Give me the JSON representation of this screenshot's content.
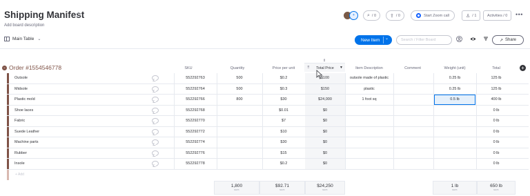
{
  "board": {
    "title": "Shipping Manifest",
    "subtitle": "Add board description"
  },
  "header": {
    "activity_count": "/ 0",
    "share_count": "/ 0",
    "zoom_label": "Start Zoom call",
    "members_count": "/ 1",
    "activities_label": "Activities / 0",
    "more_label": "•••"
  },
  "toolbar": {
    "view_label": "Main Table",
    "new_item_label": "New Item",
    "search_placeholder": "Search / Filter Board",
    "share_label": "Share"
  },
  "group": {
    "title": "Order #1554546778",
    "color": "#7f5347"
  },
  "columns": {
    "sku": "SKU",
    "quantity": "Quantity",
    "price_per_unit": "Price per unit",
    "total_price": "Total Price",
    "item_description": "Item Description",
    "comment": "Comment",
    "weight": "Weight (unit)",
    "total": "Total"
  },
  "rows": [
    {
      "name": "Outsole",
      "sku": "552292763",
      "quantity": "500",
      "price": "$0.2",
      "total_price": "$100",
      "description": "outsole made of plastic",
      "comment": "",
      "weight": "0.25 lb",
      "total": "125 lb"
    },
    {
      "name": "Midsole",
      "sku": "552292764",
      "quantity": "500",
      "price": "$0.3",
      "total_price": "$150",
      "description": "plastic",
      "comment": "",
      "weight": "0.25 lb",
      "total": "125 lb"
    },
    {
      "name": "Plastic mold",
      "sku": "552292766",
      "quantity": "800",
      "price": "$30",
      "total_price": "$24,000",
      "description": "1 foot sq",
      "comment": "",
      "weight": "0.5 lb",
      "total": "400 lb"
    },
    {
      "name": "Shoe laces",
      "sku": "552292768",
      "quantity": "",
      "price": "$0.01",
      "total_price": "$0",
      "description": "",
      "comment": "",
      "weight": "",
      "total": "0 lb"
    },
    {
      "name": "Fabric",
      "sku": "552292770",
      "quantity": "",
      "price": "$7",
      "total_price": "$0",
      "description": "",
      "comment": "",
      "weight": "",
      "total": "0 lb"
    },
    {
      "name": "Suede Leather",
      "sku": "552292772",
      "quantity": "",
      "price": "$10",
      "total_price": "$0",
      "description": "",
      "comment": "",
      "weight": "",
      "total": "0 lb"
    },
    {
      "name": "Machine parts",
      "sku": "552292774",
      "quantity": "",
      "price": "$30",
      "total_price": "$0",
      "description": "",
      "comment": "",
      "weight": "",
      "total": "0 lb"
    },
    {
      "name": "Rubber",
      "sku": "552292776",
      "quantity": "",
      "price": "$15",
      "total_price": "$0",
      "description": "",
      "comment": "",
      "weight": "",
      "total": "0 lb"
    },
    {
      "name": "Insole",
      "sku": "552292778",
      "quantity": "",
      "price": "$0.2",
      "total_price": "$0",
      "description": "",
      "comment": "",
      "weight": "",
      "total": "0 lb"
    }
  ],
  "add_row_label": "+ Add",
  "summary": {
    "quantity": "1,800",
    "price": "$92.71",
    "total_price": "$24,250",
    "weight": "1 lb",
    "total": "650 lb",
    "label": "sum"
  },
  "icons": {
    "star": "star-icon",
    "table": "table-icon",
    "person": "person-icon",
    "eye": "eye-icon",
    "filter": "filter-icon",
    "add_column": "plus-circle-icon"
  }
}
